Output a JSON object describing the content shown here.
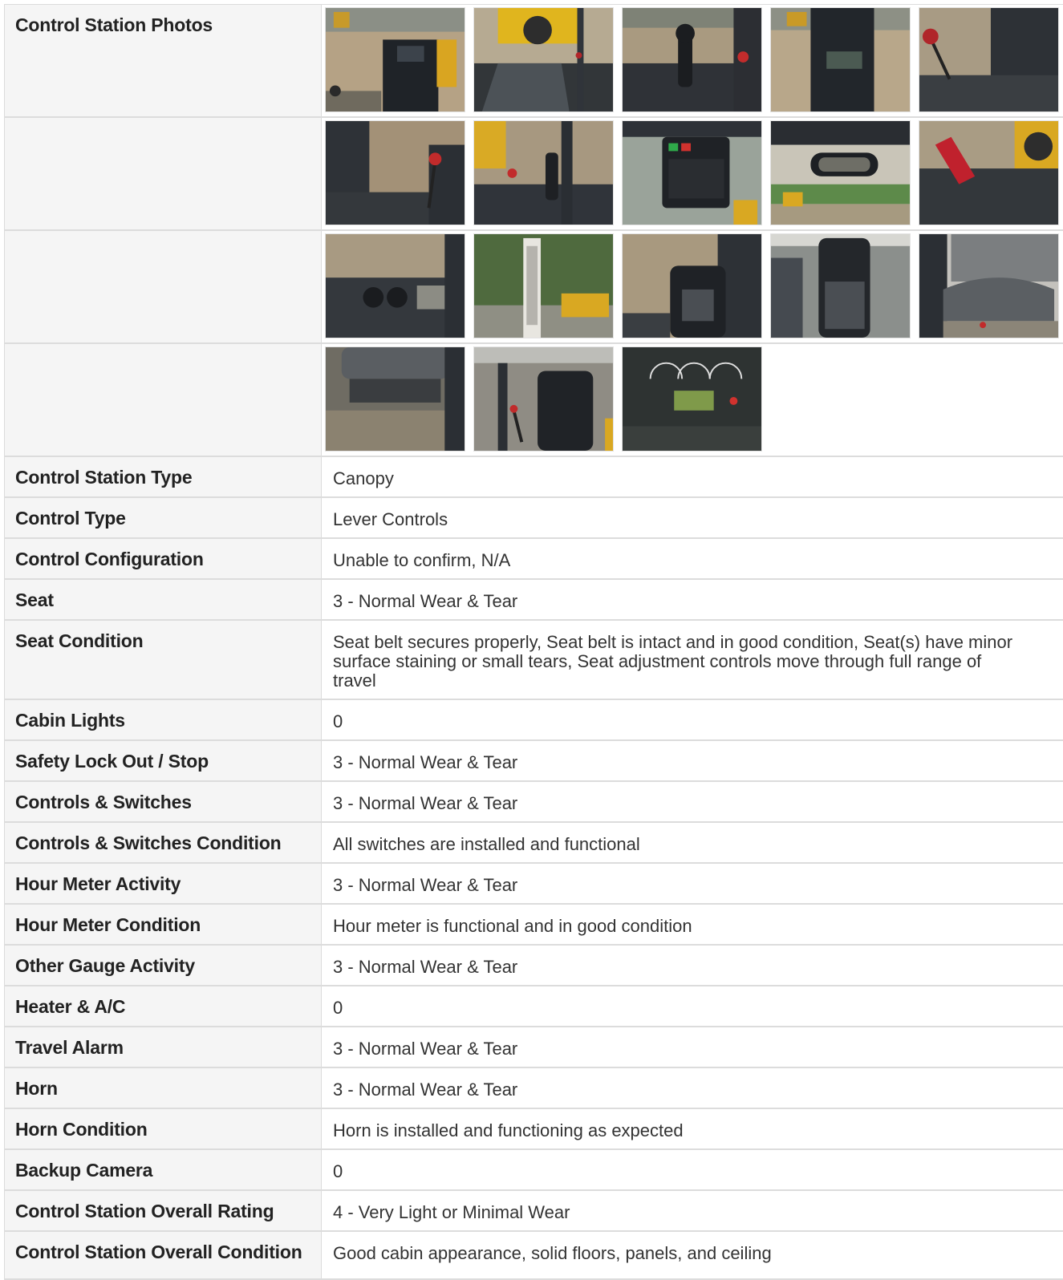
{
  "photos": {
    "label": "Control Station Photos",
    "rows": [
      [
        "seat-back-dirt",
        "yellow-machine-seat",
        "joystick-lever",
        "display-screen-front",
        "red-knob-floor"
      ],
      [
        "canopy-floor-lever",
        "joystick-side",
        "keypad-panel",
        "mirror-yard",
        "red-bracket-floor"
      ],
      [
        "cup-holders",
        "decal-sticker",
        "seat-yard-view",
        "seat-interior",
        "seat-close"
      ],
      [
        "seat-underside",
        "seat-lever-side",
        "gauge-cluster"
      ]
    ]
  },
  "specs": [
    {
      "label": "Control Station Type",
      "value": "Canopy"
    },
    {
      "label": "Control Type",
      "value": "Lever Controls"
    },
    {
      "label": "Control Configuration",
      "value": "Unable to confirm, N/A"
    },
    {
      "label": "Seat",
      "value": "3 - Normal Wear & Tear"
    },
    {
      "label": "Seat Condition",
      "value": "Seat belt secures properly, Seat belt is intact and in good condition, Seat(s) have minor surface staining or small tears, Seat adjustment controls move through full range of travel"
    },
    {
      "label": "Cabin Lights",
      "value": "0"
    },
    {
      "label": "Safety Lock Out / Stop",
      "value": "3 - Normal Wear & Tear"
    },
    {
      "label": "Controls & Switches",
      "value": "3 - Normal Wear & Tear"
    },
    {
      "label": "Controls & Switches Condition",
      "value": "All switches are installed and functional"
    },
    {
      "label": "Hour Meter Activity",
      "value": "3 - Normal Wear & Tear"
    },
    {
      "label": "Hour Meter Condition",
      "value": "Hour meter is functional and in good condition"
    },
    {
      "label": "Other Gauge Activity",
      "value": "3 - Normal Wear & Tear"
    },
    {
      "label": "Heater & A/C",
      "value": "0"
    },
    {
      "label": "Travel Alarm",
      "value": "3 - Normal Wear & Tear"
    },
    {
      "label": "Horn",
      "value": "3 - Normal Wear & Tear"
    },
    {
      "label": "Horn Condition",
      "value": "Horn is installed and functioning as expected"
    },
    {
      "label": "Backup Camera",
      "value": "0"
    },
    {
      "label": "Control Station Overall Rating",
      "value": "4 - Very Light or Minimal Wear"
    },
    {
      "label": "Control Station Overall Condition",
      "value": "Good cabin appearance, solid floors, panels, and ceiling"
    }
  ],
  "colors": {
    "label_bg": "#f5f5f5",
    "border": "#dcdcdc",
    "text": "#333333",
    "machine_yellow": "#e0b020",
    "dirt": "#b9a585",
    "dark_plastic": "#2c3036"
  }
}
